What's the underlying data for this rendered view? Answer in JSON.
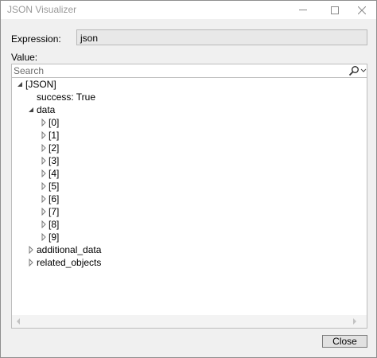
{
  "window": {
    "title": "JSON Visualizer"
  },
  "expression": {
    "label": "Expression:",
    "value": "json"
  },
  "value_section": {
    "label": "Value:"
  },
  "search": {
    "placeholder": "Search",
    "value": ""
  },
  "tree": {
    "root": {
      "label": "[JSON]",
      "expanded": true
    },
    "success": {
      "label": "success: True"
    },
    "data": {
      "label": "data",
      "expanded": true,
      "items": [
        "[0]",
        "[1]",
        "[2]",
        "[3]",
        "[4]",
        "[5]",
        "[6]",
        "[7]",
        "[8]",
        "[9]"
      ]
    },
    "additional_data": {
      "label": "additional_data",
      "expanded": false
    },
    "related_objects": {
      "label": "related_objects",
      "expanded": false
    }
  },
  "buttons": {
    "close_label": "Close"
  },
  "colors": {
    "window_background": "#f0f0f0",
    "field_background": "#e8e8e8",
    "tree_background": "#ffffff",
    "title_text": "#999999"
  },
  "icons": {
    "expanded": "expanded-arrow-icon",
    "collapsed": "collapsed-arrow-icon",
    "search": "search-icon"
  }
}
